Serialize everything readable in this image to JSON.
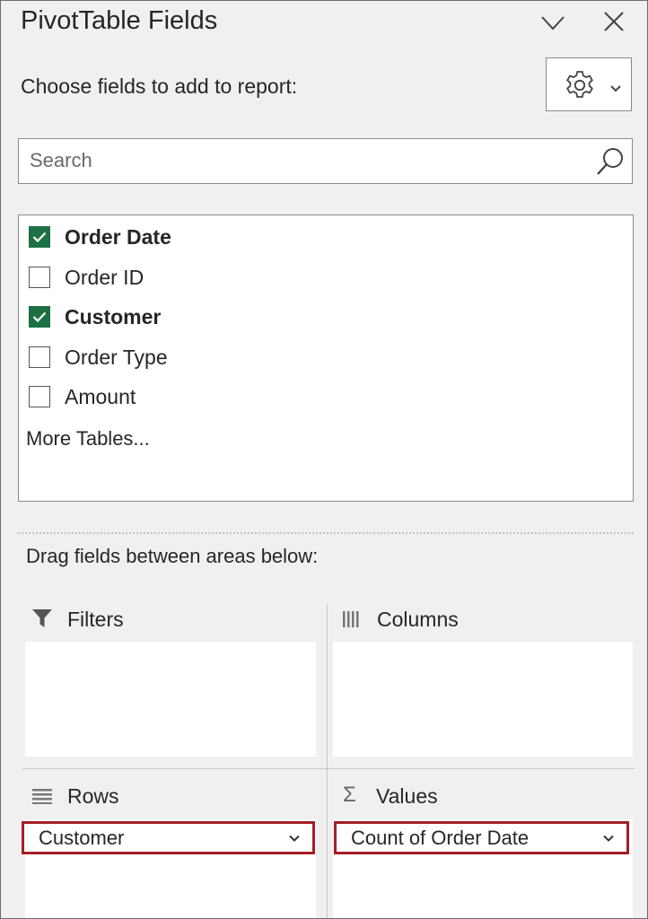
{
  "pane": {
    "title": "PivotTable Fields",
    "choose_label": "Choose fields to add to report:"
  },
  "search": {
    "placeholder": "Search"
  },
  "fields": [
    {
      "label": "Order Date",
      "checked": true
    },
    {
      "label": "Order ID",
      "checked": false
    },
    {
      "label": "Customer",
      "checked": true
    },
    {
      "label": "Order Type",
      "checked": false
    },
    {
      "label": "Amount",
      "checked": false
    }
  ],
  "more_tables": "More Tables...",
  "drag_label": "Drag fields between areas below:",
  "areas": {
    "filters": {
      "title": "Filters",
      "icon": "filter-icon"
    },
    "columns": {
      "title": "Columns",
      "icon": "columns-icon"
    },
    "rows": {
      "title": "Rows",
      "icon": "rows-icon",
      "items": [
        "Customer"
      ]
    },
    "values": {
      "title": "Values",
      "icon": "sigma-icon",
      "items": [
        "Count of Order Date"
      ]
    }
  },
  "colors": {
    "checkbox_checked": "#1d7044",
    "highlight_border": "#a51d24"
  }
}
